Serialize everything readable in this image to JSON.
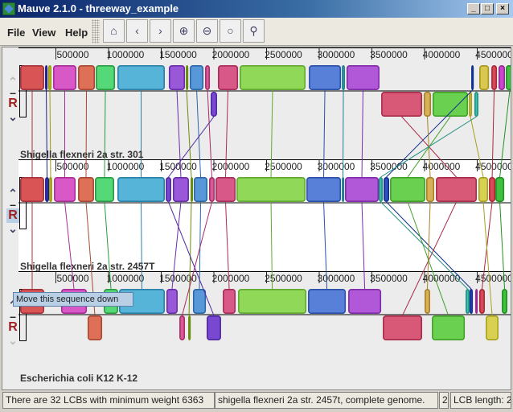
{
  "window": {
    "title": "Mauve 2.1.0 - threeway_example",
    "minimize": "_",
    "maximize": "□",
    "close": "×"
  },
  "menu": [
    "File",
    "View",
    "Help"
  ],
  "toolbar": [
    {
      "name": "home-icon",
      "glyph": "⌂"
    },
    {
      "name": "scroll-left-icon",
      "glyph": "‹"
    },
    {
      "name": "scroll-right-icon",
      "glyph": "›"
    },
    {
      "name": "zoom-in-icon",
      "glyph": "⊕"
    },
    {
      "name": "zoom-out-icon",
      "glyph": "⊖"
    },
    {
      "name": "zoom-reset-icon",
      "glyph": "○"
    },
    {
      "name": "find-icon",
      "glyph": "⚲"
    }
  ],
  "axis": {
    "ticks": [
      500000,
      1000000,
      1500000,
      2000000,
      2500000,
      3000000,
      3500000,
      4000000,
      4500000
    ]
  },
  "controls": {
    "up": "⌃",
    "minus": "–",
    "reverse": "R",
    "down": "⌄"
  },
  "tooltip": "Move this sequence down",
  "genomes": [
    {
      "name": "Shigella flexneri 2a str. 301",
      "selected": false,
      "blocks": [
        {
          "id": 1,
          "s": 0,
          "e": 229000,
          "c": "#d95555",
          "b": "#a8323c"
        },
        {
          "id": 2,
          "s": 237000,
          "e": 260000,
          "c": "#3434b8",
          "b": "#20208a"
        },
        {
          "id": 3,
          "s": 267000,
          "e": 298000,
          "c": "#c8c830",
          "b": "#9a9a10"
        },
        {
          "id": 4,
          "s": 313000,
          "e": 534000,
          "c": "#d858c8",
          "b": "#a82c98"
        },
        {
          "id": 5,
          "s": 550000,
          "e": 710000,
          "c": "#de7058",
          "b": "#a84832"
        },
        {
          "id": 6,
          "s": 718000,
          "e": 901000,
          "c": "#55d878",
          "b": "#2a9a40"
        },
        {
          "id": 7,
          "s": 924000,
          "e": 1374000,
          "c": "#55b4d8",
          "b": "#2a80a8"
        },
        {
          "id": 8,
          "s": 1412000,
          "e": 1565000,
          "c": "#9858d8",
          "b": "#6a2ca8"
        },
        {
          "id": 9,
          "s": 1573000,
          "e": 1588000,
          "c": "#90b030",
          "b": "#6a8a10"
        },
        {
          "id": 10,
          "s": 1611000,
          "e": 1741000,
          "c": "#5898d8",
          "b": "#2a68a8"
        },
        {
          "id": 11,
          "s": 1756000,
          "e": 1802000,
          "c": "#d85898",
          "b": "#a82c68"
        },
        {
          "id": 12,
          "s": 1878000,
          "e": 2069000,
          "c": "#d85888",
          "b": "#a82c58"
        },
        {
          "id": 13,
          "s": 2084000,
          "e": 2710000,
          "c": "#90d858",
          "b": "#60a830"
        },
        {
          "id": 14,
          "s": 2741000,
          "e": 3046000,
          "c": "#5880d8",
          "b": "#2a50a8"
        },
        {
          "id": 15,
          "s": 3054000,
          "e": 3084000,
          "c": "#40b0c0",
          "b": "#208090"
        },
        {
          "id": 16,
          "s": 3099000,
          "e": 3412000,
          "c": "#b058d8",
          "b": "#802ca8"
        },
        {
          "id": 17,
          "s": 4283000,
          "e": 4306000,
          "c": "#3050c0",
          "b": "#103090"
        },
        {
          "id": 18,
          "s": 4359000,
          "e": 4451000,
          "c": "#d8c850",
          "b": "#a89820"
        },
        {
          "id": 19,
          "s": 4474000,
          "e": 4527000,
          "c": "#d84858",
          "b": "#a82838"
        },
        {
          "id": 20,
          "s": 4542000,
          "e": 4603000,
          "c": "#c848c8",
          "b": "#982898"
        },
        {
          "id": 21,
          "s": 4611000,
          "e": 4687000,
          "c": "#40c040",
          "b": "#209020"
        },
        {
          "id": 22,
          "s": 1809000,
          "e": 1870000,
          "c": "#7848d0",
          "b": "#5028a0",
          "below": true
        },
        {
          "id": 23,
          "s": 3428000,
          "e": 3817000,
          "c": "#d85878",
          "b": "#a82c48",
          "below": true
        },
        {
          "id": 24,
          "s": 3832000,
          "e": 3901000,
          "c": "#d8b058",
          "b": "#a88028",
          "below": true
        },
        {
          "id": 25,
          "s": 3916000,
          "e": 4252000,
          "c": "#6ad050",
          "b": "#40a028",
          "below": true
        },
        {
          "id": 26,
          "s": 4260000,
          "e": 4290000,
          "c": "#d8d050",
          "b": "#a8a020",
          "below": true
        },
        {
          "id": 27,
          "s": 4313000,
          "e": 4351000,
          "c": "#40c0b0",
          "b": "#209080",
          "below": true
        }
      ]
    },
    {
      "name": "Shigella flexneri 2a str. 2457T",
      "selected": true,
      "blocks": [
        {
          "id": 1,
          "s": 0,
          "e": 229000
        },
        {
          "id": 2,
          "s": 237000,
          "e": 275000
        },
        {
          "id": 3,
          "s": 275000,
          "e": 305000
        },
        {
          "id": 4,
          "s": 321000,
          "e": 527000
        },
        {
          "id": 5,
          "s": 550000,
          "e": 702000
        },
        {
          "id": 6,
          "s": 710000,
          "e": 893000
        },
        {
          "id": 7,
          "s": 924000,
          "e": 1374000
        },
        {
          "id": 22,
          "s": 1382000,
          "e": 1435000
        },
        {
          "id": 8,
          "s": 1450000,
          "e": 1603000
        },
        {
          "id": 9,
          "s": 1618000,
          "e": 1634000
        },
        {
          "id": 10,
          "s": 1649000,
          "e": 1779000
        },
        {
          "id": 11,
          "s": 1794000,
          "e": 1847000
        },
        {
          "id": 12,
          "s": 1855000,
          "e": 2046000
        },
        {
          "id": 13,
          "s": 2054000,
          "e": 2710000
        },
        {
          "id": 14,
          "s": 2718000,
          "e": 3046000
        },
        {
          "id": 15,
          "s": 3054000,
          "e": 3076000
        },
        {
          "id": 16,
          "s": 3084000,
          "e": 3405000
        },
        {
          "id": 27,
          "s": 3405000,
          "e": 3443000
        },
        {
          "id": 17,
          "s": 3451000,
          "e": 3504000
        },
        {
          "id": 25,
          "s": 3512000,
          "e": 3848000
        },
        {
          "id": 24,
          "s": 3855000,
          "e": 3932000
        },
        {
          "id": 23,
          "s": 3947000,
          "e": 4336000
        },
        {
          "id": 26,
          "s": 4351000,
          "e": 4443000
        },
        {
          "id": 19,
          "s": 4451000,
          "e": 4512000
        },
        {
          "id": 21,
          "s": 4512000,
          "e": 4596000
        }
      ]
    },
    {
      "name": "Escherichia coli K12 K-12",
      "selected": false,
      "blocks": [
        {
          "id": 1,
          "s": 0,
          "e": 229000
        },
        {
          "id": 4,
          "s": 389000,
          "e": 634000
        },
        {
          "id": 6,
          "s": 794000,
          "e": 931000
        },
        {
          "id": 7,
          "s": 939000,
          "e": 1374000
        },
        {
          "id": 8,
          "s": 1389000,
          "e": 1496000
        },
        {
          "id": 10,
          "s": 1641000,
          "e": 1764000
        },
        {
          "id": 12,
          "s": 1924000,
          "e": 2046000
        },
        {
          "id": 13,
          "s": 2069000,
          "e": 2718000
        },
        {
          "id": 14,
          "s": 2733000,
          "e": 3092000
        },
        {
          "id": 16,
          "s": 3115000,
          "e": 3428000
        },
        {
          "id": 24,
          "s": 3840000,
          "e": 3893000
        },
        {
          "id": 27,
          "s": 4229000,
          "e": 4267000
        },
        {
          "id": 17,
          "s": 4267000,
          "e": 4298000
        },
        {
          "id": 20,
          "s": 4321000,
          "e": 4336000
        },
        {
          "id": 19,
          "s": 4359000,
          "e": 4412000
        },
        {
          "id": 21,
          "s": 4573000,
          "e": 4626000
        },
        {
          "id": 5,
          "s": 641000,
          "e": 779000,
          "below": true
        },
        {
          "id": 11,
          "s": 1512000,
          "e": 1565000,
          "below": true
        },
        {
          "id": 9,
          "s": 1596000,
          "e": 1611000,
          "below": true
        },
        {
          "id": 22,
          "s": 1771000,
          "e": 1908000,
          "below": true
        },
        {
          "id": 23,
          "s": 3443000,
          "e": 3817000,
          "below": true
        },
        {
          "id": 25,
          "s": 3909000,
          "e": 4222000,
          "below": true
        },
        {
          "id": 26,
          "s": 4420000,
          "e": 4542000,
          "below": true
        }
      ]
    }
  ],
  "status": {
    "message": "There are 32 LCBs with minimum weight 6363",
    "sequence": "shigella flexneri 2a str. 2457t, complete genome.",
    "index": "2",
    "lcb": "LCB length: 2"
  }
}
